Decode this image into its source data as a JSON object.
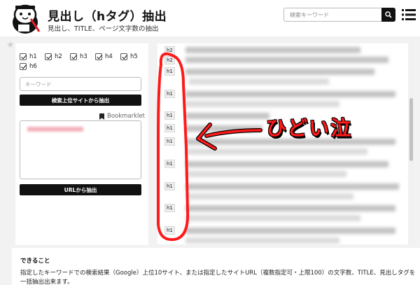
{
  "header": {
    "title": "見出し（hタグ）抽出",
    "subtitle": "見出し、TITLE、ページ文字数の抽出",
    "search_placeholder": "検索キーワード"
  },
  "form": {
    "checkboxes": [
      {
        "label": "h1",
        "checked": true
      },
      {
        "label": "h2",
        "checked": true
      },
      {
        "label": "h3",
        "checked": true
      },
      {
        "label": "h4",
        "checked": true
      },
      {
        "label": "h5",
        "checked": true
      },
      {
        "label": "h6",
        "checked": true
      }
    ],
    "keyword_placeholder": "キーワード",
    "search_button": "検索上位サイトから抽出",
    "bookmarklet_label": "Bookmarklet",
    "url_button": "URLから抽出"
  },
  "results": {
    "tags": [
      "h2",
      "h2",
      "h1",
      "h1",
      "h1",
      "h1",
      "h1",
      "h1",
      "h1",
      "h1",
      "h1"
    ]
  },
  "annotation": {
    "text": "ひどい泣",
    "color": "#ff1a1a"
  },
  "about": {
    "title": "できること",
    "text": "指定したキーワードでの検索結果（Google）上位10サイト、または指定したサイトURL（複数指定可・上限100）の文字数、TITLE、見出しタグを一括抽出出来ます。"
  }
}
